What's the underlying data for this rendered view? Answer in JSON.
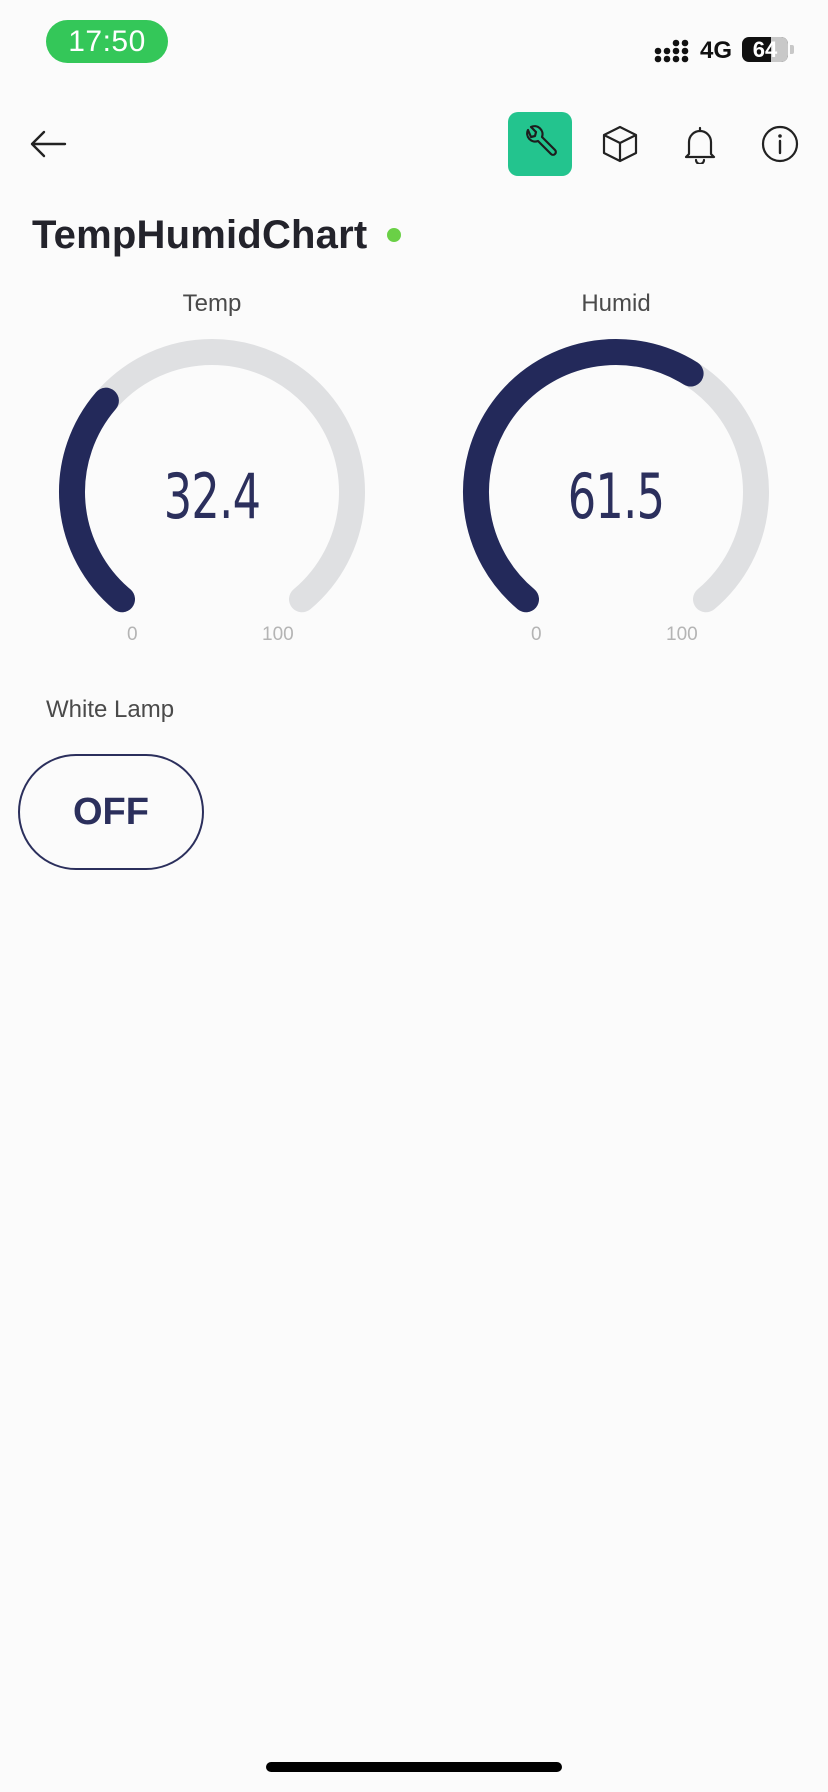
{
  "status_bar": {
    "time": "17:50",
    "network": "4G",
    "battery": "64",
    "battery_level": 0.64
  },
  "toolbar": {
    "back": "arrow-left-icon",
    "wrench": "wrench-icon",
    "cube": "cube-icon",
    "bell": "bell-icon",
    "info": "info-icon",
    "active_color": "#23c48e"
  },
  "header": {
    "title": "TempHumidChart",
    "status_color": "#6ad046"
  },
  "gauges": {
    "temp": {
      "label": "Temp",
      "value": "32.4",
      "min": "0",
      "max": "100",
      "fraction": 0.324
    },
    "humid": {
      "label": "Humid",
      "value": "61.5",
      "min": "0",
      "max": "100",
      "fraction": 0.615
    }
  },
  "switch": {
    "label": "White Lamp",
    "state": "OFF",
    "color": "#2b2f5c"
  }
}
